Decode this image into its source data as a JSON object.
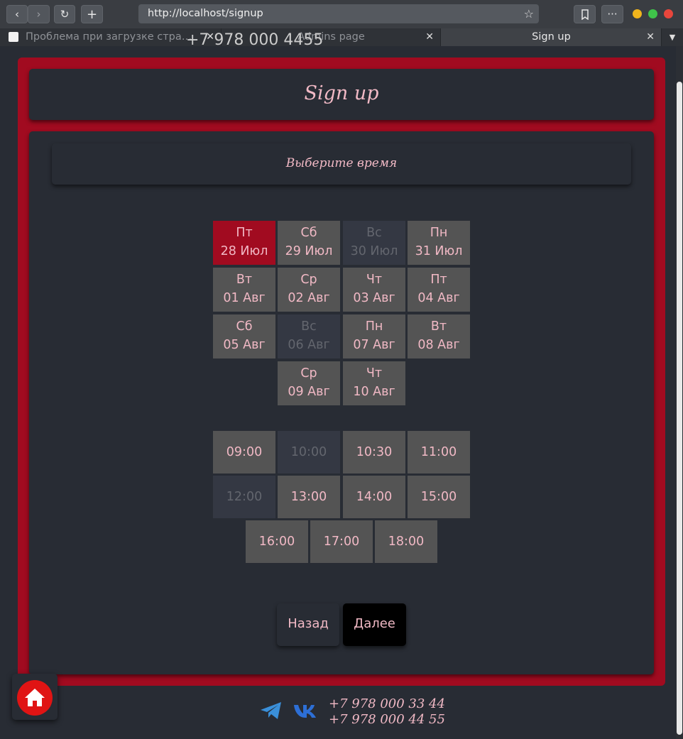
{
  "browser": {
    "url": "http://localhost/signup",
    "tabs": [
      {
        "title": "Проблема при загрузке стра…"
      },
      {
        "title": "Admins page"
      },
      {
        "title": "Sign up"
      }
    ],
    "colors": {
      "min": "#f0b41c",
      "max": "#3fc34a",
      "close": "#e8463c"
    }
  },
  "page": {
    "peek_text": "+7 978 000 4455",
    "title": "Sign up",
    "subtitle": "Выберите время",
    "dates": [
      {
        "day": "Пт",
        "date": "28 Июл",
        "state": "selected"
      },
      {
        "day": "Сб",
        "date": "29 Июл",
        "state": "normal"
      },
      {
        "day": "Вс",
        "date": "30 Июл",
        "state": "disabled"
      },
      {
        "day": "Пн",
        "date": "31 Июл",
        "state": "normal"
      },
      {
        "day": "Вт",
        "date": "01 Авг",
        "state": "normal"
      },
      {
        "day": "Ср",
        "date": "02 Авг",
        "state": "normal"
      },
      {
        "day": "Чт",
        "date": "03 Авг",
        "state": "normal"
      },
      {
        "day": "Пт",
        "date": "04 Авг",
        "state": "normal"
      },
      {
        "day": "Сб",
        "date": "05 Авг",
        "state": "normal"
      },
      {
        "day": "Вс",
        "date": "06 Авг",
        "state": "disabled"
      },
      {
        "day": "Пн",
        "date": "07 Авг",
        "state": "normal"
      },
      {
        "day": "Вт",
        "date": "08 Авг",
        "state": "normal"
      },
      {
        "day": "Ср",
        "date": "09 Авг",
        "state": "normal"
      },
      {
        "day": "Чт",
        "date": "10 Авг",
        "state": "normal"
      }
    ],
    "times": [
      {
        "time": "09:00",
        "state": "normal"
      },
      {
        "time": "10:00",
        "state": "disabled"
      },
      {
        "time": "10:30",
        "state": "normal"
      },
      {
        "time": "11:00",
        "state": "normal"
      },
      {
        "time": "12:00",
        "state": "disabled"
      },
      {
        "time": "13:00",
        "state": "normal"
      },
      {
        "time": "14:00",
        "state": "normal"
      },
      {
        "time": "15:00",
        "state": "normal"
      },
      {
        "time": "16:00",
        "state": "normal"
      },
      {
        "time": "17:00",
        "state": "normal"
      },
      {
        "time": "18:00",
        "state": "normal"
      }
    ],
    "back_label": "Назад",
    "next_label": "Далее"
  },
  "footer": {
    "phone1": "+7 978 000 33 44",
    "phone2": "+7 978 000 44 55",
    "icons": [
      "home-icon",
      "telegram-icon",
      "vk-icon"
    ]
  },
  "colors": {
    "accent": "#a10b20",
    "text_pink": "#f1b9c5",
    "background": "#282c34",
    "cell": "#545454"
  }
}
